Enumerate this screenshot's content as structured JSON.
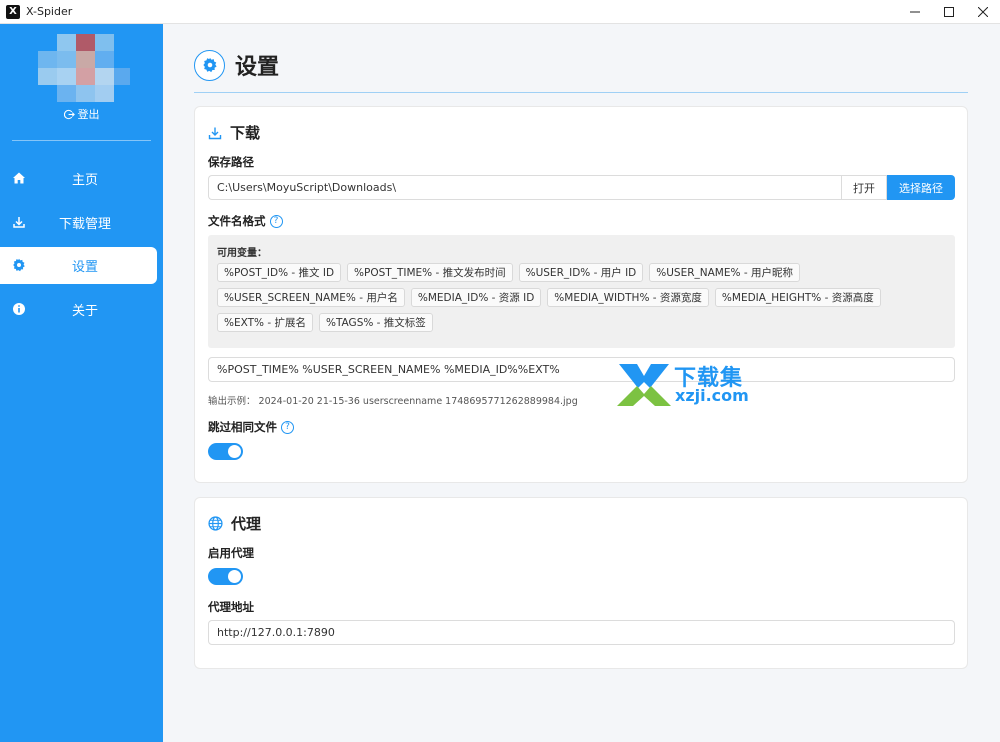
{
  "window": {
    "title": "X-Spider",
    "app_icon_glyph": "X"
  },
  "sidebar": {
    "logout_label": "登出",
    "items": [
      {
        "label": "主页",
        "icon": "home-icon"
      },
      {
        "label": "下载管理",
        "icon": "download-icon"
      },
      {
        "label": "设置",
        "icon": "gear-icon",
        "active": true
      },
      {
        "label": "关于",
        "icon": "info-icon"
      }
    ]
  },
  "page": {
    "title": "设置"
  },
  "download": {
    "section_title": "下载",
    "save_path_label": "保存路径",
    "save_path_value": "C:\\Users\\MoyuScript\\Downloads\\",
    "open_button": "打开",
    "choose_button": "选择路径",
    "filename_format_label": "文件名格式",
    "help_glyph": "?",
    "available_vars_label": "可用变量：",
    "variables": [
      [
        "%POST_ID% - 推文 ID",
        "%POST_TIME% - 推文发布时间",
        "%USER_ID% - 用户 ID",
        "%USER_NAME% - 用户昵称"
      ],
      [
        "%USER_SCREEN_NAME% - 用户名",
        "%MEDIA_ID% - 资源 ID",
        "%MEDIA_WIDTH% - 资源宽度",
        "%MEDIA_HEIGHT% - 资源高度"
      ],
      [
        "%EXT% - 扩展名",
        "%TAGS% - 推文标签"
      ]
    ],
    "format_value": "%POST_TIME% %USER_SCREEN_NAME% %MEDIA_ID%%EXT%",
    "example_label": "输出示例：",
    "example_value": "2024-01-20 21-15-36 userscreenname 1748695771262889984.jpg",
    "skip_same_label": "跳过相同文件",
    "skip_same_enabled": true
  },
  "proxy": {
    "section_title": "代理",
    "enable_label": "启用代理",
    "enabled": true,
    "address_label": "代理地址",
    "address_value": "http://127.0.0.1:7890"
  },
  "watermark": {
    "title": "下载集",
    "subtitle": "xzji.com"
  },
  "colors": {
    "accent": "#2196f3",
    "sidebar_bg": "#2196f3",
    "page_bg": "#f4f6f9"
  }
}
